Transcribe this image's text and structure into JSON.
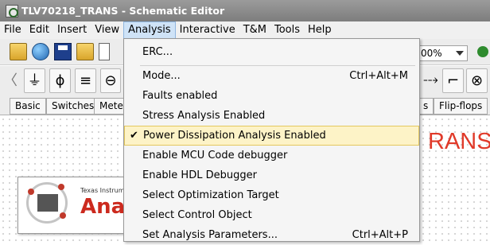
{
  "window": {
    "title": "TLV70218_TRANS - Schematic Editor"
  },
  "menubar": {
    "items": [
      {
        "label": "File"
      },
      {
        "label": "Edit"
      },
      {
        "label": "Insert"
      },
      {
        "label": "View"
      },
      {
        "label": "Analysis"
      },
      {
        "label": "Interactive"
      },
      {
        "label": "T&M"
      },
      {
        "label": "Tools"
      },
      {
        "label": "Help"
      }
    ]
  },
  "toolbar": {
    "zoom_value": "00%"
  },
  "component_tabs": [
    "Basic",
    "Switches",
    "Meter",
    "s",
    "Flip-flops"
  ],
  "analysis_menu": {
    "items": [
      {
        "label": "ERC...",
        "shortcut": ""
      },
      {
        "label": "Mode...",
        "shortcut": "Ctrl+Alt+M"
      },
      {
        "label": "Faults enabled",
        "shortcut": ""
      },
      {
        "label": "Stress Analysis Enabled",
        "shortcut": ""
      },
      {
        "label": "Power Dissipation Analysis Enabled",
        "shortcut": "",
        "checked": true
      },
      {
        "label": "Enable MCU Code debugger",
        "shortcut": ""
      },
      {
        "label": "Enable HDL Debugger",
        "shortcut": ""
      },
      {
        "label": "Select Optimization Target",
        "shortcut": ""
      },
      {
        "label": "Select Control Object",
        "shortcut": ""
      },
      {
        "label": "Set Analysis Parameters...",
        "shortcut": "Ctrl+Alt+P"
      }
    ],
    "check_mark": "✔"
  },
  "canvas": {
    "title_fragment": "RANS",
    "logo_company": "Texas Instrum",
    "logo_word": "Anal"
  },
  "colors": {
    "highlight": "#fdf3c7",
    "accent_red": "#e03a2a",
    "menu_active": "#cfe3f7"
  }
}
